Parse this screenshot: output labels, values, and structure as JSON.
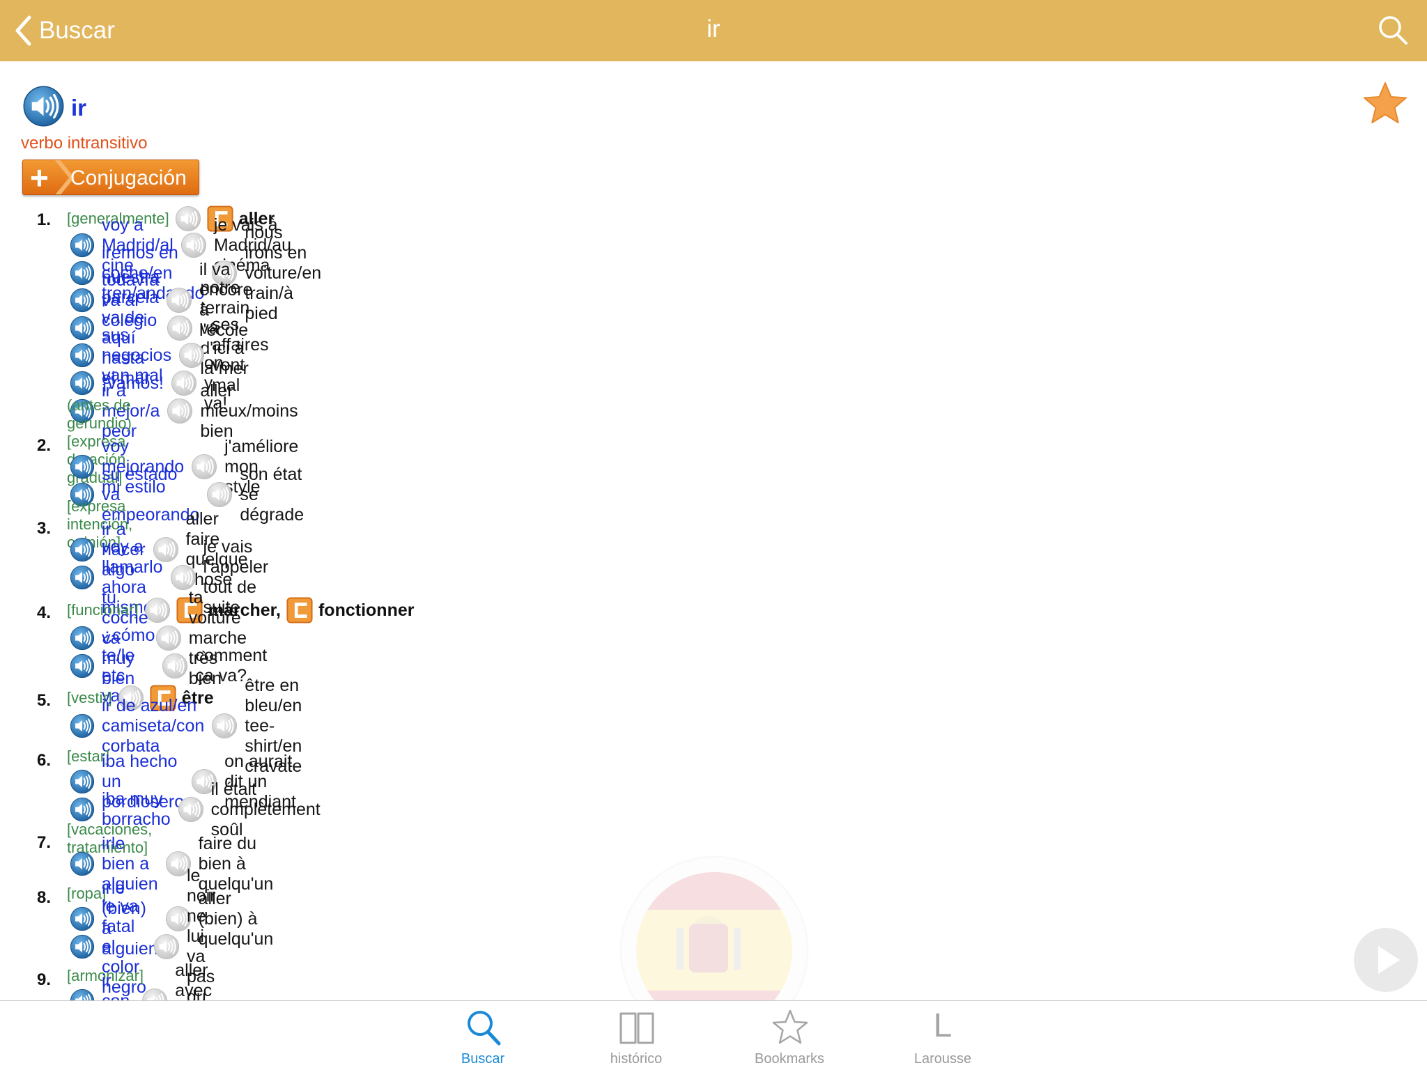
{
  "nav": {
    "back_label": "Buscar",
    "title": "ir"
  },
  "entry": {
    "headword": "ir",
    "pos": "verbo intransitivo",
    "conj_label": "Conjugación"
  },
  "senses": [
    {
      "num": "1.",
      "context": "[generalmente]",
      "translations": [
        "aller"
      ],
      "examples": [
        {
          "es": "voy a Madrid/al cine",
          "fr": "je vais à Madrid/au cinéma"
        },
        {
          "es": "iremos en coche/en tren/andando",
          "fr": "nous irons en voiture/en train/à pied"
        },
        {
          "es": "todavía va al colegio",
          "fr": "il va encore à l'école"
        },
        {
          "es": "nuestra parcela va de aquí hasta el mar",
          "fr": "notre terrain va d'ici à la mer"
        },
        {
          "es": "sus negocios van mal",
          "fr": "ses affaires vont mal"
        },
        {
          "es": "¡vamos!",
          "fr": "on y va!"
        },
        {
          "es": "ir a mejor/a peor",
          "fr": "aller mieux/moins bien"
        }
      ]
    },
    {
      "num": "2.",
      "context": "(antes de gerundio) [expresa duración gradual]",
      "translations": [],
      "examples": [
        {
          "es": "voy mejorando mi estilo",
          "fr": "j'améliore mon style"
        },
        {
          "es": "su estado va empeorando",
          "fr": "son état se dégrade"
        }
      ]
    },
    {
      "num": "3.",
      "context": "[expresa intención, opinión]",
      "translations": [],
      "examples": [
        {
          "es": "ir a hacer algo",
          "fr": "aller faire quelque chose"
        },
        {
          "es": "voy a llamarlo ahora mismo",
          "fr": "je vais l'appeler tout de suite"
        }
      ]
    },
    {
      "num": "4.",
      "context": "[funcionar]",
      "translations": [
        "marcher,",
        "fonctionner"
      ],
      "examples": [
        {
          "es": "tu coche va muy bien",
          "fr": "ta voiture marche très bien"
        },
        {
          "es": "¿cómo te/le etc va?",
          "fr": "comment ça va?"
        }
      ]
    },
    {
      "num": "5.",
      "context": "[vestir]",
      "translations": [
        "être"
      ],
      "examples": [
        {
          "es": "ir de azul/en camiseta/con corbata",
          "fr": "être en bleu/en tee-shirt/en cravate"
        }
      ]
    },
    {
      "num": "6.",
      "context": "[estar]",
      "translations": [],
      "examples": [
        {
          "es": "iba hecho un pordiosero",
          "fr": "on aurait dit un mendiant"
        },
        {
          "es": "iba muy borracho",
          "fr": "il était complètement soûl"
        }
      ]
    },
    {
      "num": "7.",
      "context": "[vacaciones, tratamiento]",
      "translations": [],
      "examples": [
        {
          "es": "irle bien a alguien",
          "fr": "faire du bien à quelqu'un"
        }
      ]
    },
    {
      "num": "8.",
      "context": "[ropa]",
      "translations": [],
      "examples": [
        {
          "es": "irle (bien) a alguien",
          "fr": "aller (bien) à quelqu'un"
        },
        {
          "es": "le va fatal el color negro",
          "fr": "le noir ne lui va pas du tout"
        }
      ]
    },
    {
      "num": "9.",
      "context": "[armonizar]",
      "translations": [],
      "examples": [
        {
          "es": "ir con algo",
          "fr": "aller avec quelque chose"
        }
      ]
    }
  ],
  "tabs": [
    {
      "label": "Buscar",
      "icon": "search-icon",
      "active": true
    },
    {
      "label": "histórico",
      "icon": "book-icon",
      "active": false
    },
    {
      "label": "Bookmarks",
      "icon": "star-outline-icon",
      "active": false
    },
    {
      "label": "Larousse",
      "icon": "larousse-l-icon",
      "active": false
    }
  ],
  "colors": {
    "header": "#e2b65c",
    "headword": "#1d36d9",
    "pos": "#e0501a",
    "context": "#3b8a4a",
    "spanish": "#1a2ed6",
    "tab_active": "#1a8ad6",
    "favorite_star": "#f5a04a"
  }
}
